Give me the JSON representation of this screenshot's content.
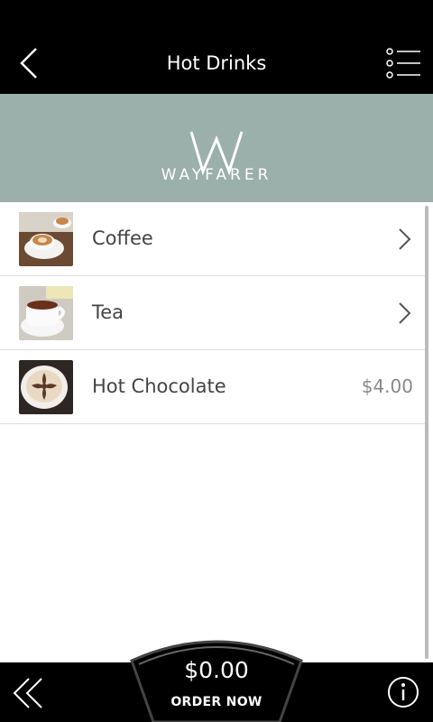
{
  "header": {
    "title": "Hot Drinks"
  },
  "banner": {
    "brand": "WAYFARER",
    "logo_icon": "wayfarer-w-logo"
  },
  "menu_items": [
    {
      "label": "Coffee",
      "price": "",
      "has_chevron": true,
      "thumb": "coffee-thumbnail"
    },
    {
      "label": "Tea",
      "price": "",
      "has_chevron": true,
      "thumb": "tea-thumbnail"
    },
    {
      "label": "Hot Chocolate",
      "price": "$4.00",
      "has_chevron": false,
      "thumb": "hot-chocolate-thumbnail"
    }
  ],
  "footer": {
    "total": "$0.00",
    "order_label": "ORDER NOW"
  },
  "colors": {
    "banner_bg": "#9bafab",
    "bar_bg": "#000000",
    "text": "#444444",
    "price": "#888888"
  }
}
